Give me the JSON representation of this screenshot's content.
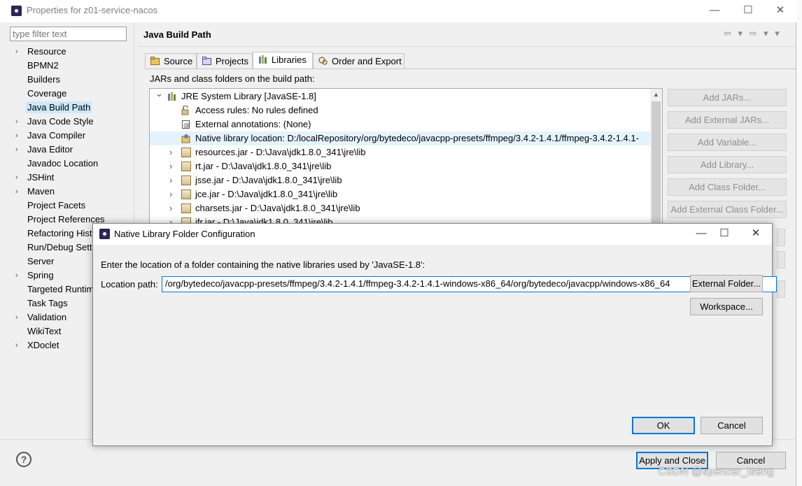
{
  "window": {
    "title": "Properties for z01-service-nacos",
    "minimize": "—",
    "maximize": "☐",
    "close": "✕"
  },
  "filter": {
    "placeholder": "type filter text"
  },
  "tree": [
    {
      "label": "Resource",
      "expandable": true
    },
    {
      "label": "BPMN2",
      "expandable": false
    },
    {
      "label": "Builders",
      "expandable": false
    },
    {
      "label": "Coverage",
      "expandable": false
    },
    {
      "label": "Java Build Path",
      "expandable": false,
      "selected": true
    },
    {
      "label": "Java Code Style",
      "expandable": true
    },
    {
      "label": "Java Compiler",
      "expandable": true
    },
    {
      "label": "Java Editor",
      "expandable": true
    },
    {
      "label": "Javadoc Location",
      "expandable": false
    },
    {
      "label": "JSHint",
      "expandable": true
    },
    {
      "label": "Maven",
      "expandable": true
    },
    {
      "label": "Project Facets",
      "expandable": false
    },
    {
      "label": "Project References",
      "expandable": false
    },
    {
      "label": "Refactoring Hist",
      "expandable": false
    },
    {
      "label": "Run/Debug Setti",
      "expandable": false
    },
    {
      "label": "Server",
      "expandable": false
    },
    {
      "label": "Spring",
      "expandable": true
    },
    {
      "label": "Targeted Runtim",
      "expandable": false
    },
    {
      "label": "Task Tags",
      "expandable": false
    },
    {
      "label": "Validation",
      "expandable": true
    },
    {
      "label": "WikiText",
      "expandable": false
    },
    {
      "label": "XDoclet",
      "expandable": true
    }
  ],
  "panel": {
    "title": "Java Build Path",
    "nav": "⇦ ▾ ⇨ ▾ ▾",
    "tabs": [
      "Source",
      "Projects",
      "Libraries",
      "Order and Export"
    ],
    "active_tab": "Libraries",
    "jars_label": "JARs and class folders on the build path:"
  },
  "libraries": [
    {
      "text": "JRE System Library [JavaSE-1.8]",
      "level": 0,
      "exp": "⌄"
    },
    {
      "text": "Access rules: No rules defined",
      "level": 1,
      "exp": ""
    },
    {
      "text": "External annotations: (None)",
      "level": 1,
      "exp": ""
    },
    {
      "text": "Native library location: D:/localRepository/org/bytedeco/javacpp-presets/ffmpeg/3.4.2-1.4.1/ffmpeg-3.4.2-1.4.1-",
      "level": 1,
      "exp": "",
      "highlight": true
    },
    {
      "text": "resources.jar - D:\\Java\\jdk1.8.0_341\\jre\\lib",
      "level": 1,
      "exp": "›"
    },
    {
      "text": "rt.jar - D:\\Java\\jdk1.8.0_341\\jre\\lib",
      "level": 1,
      "exp": "›"
    },
    {
      "text": "jsse.jar - D:\\Java\\jdk1.8.0_341\\jre\\lib",
      "level": 1,
      "exp": "›"
    },
    {
      "text": "jce.jar - D:\\Java\\jdk1.8.0_341\\jre\\lib",
      "level": 1,
      "exp": "›"
    },
    {
      "text": "charsets.jar - D:\\Java\\jdk1.8.0_341\\jre\\lib",
      "level": 1,
      "exp": "›"
    },
    {
      "text": "jfr.jar - D:\\Java\\jdk1.8.0_341\\jre\\lib",
      "level": 1,
      "exp": "›"
    }
  ],
  "side_buttons": [
    "Add JARs...",
    "Add External JARs...",
    "Add Variable...",
    "Add Library...",
    "Add Class Folder...",
    "Add External Class Folder..."
  ],
  "bottom": {
    "help": "?",
    "apply_close": "Apply and Close",
    "cancel": "Cancel"
  },
  "dialog": {
    "title": "Native Library Folder Configuration",
    "minimize": "—",
    "maximize": "☐",
    "close": "✕",
    "instruction": "Enter the location of a folder containing the native libraries used by 'JavaSE-1.8':",
    "location_label": "Location path:",
    "location_value": "/org/bytedeco/javacpp-presets/ffmpeg/3.4.2-1.4.1/ffmpeg-3.4.2-1.4.1-windows-x86_64/org/bytedeco/javacpp/windows-x86_64",
    "external_folder": "External Folder...",
    "workspace": "Workspace...",
    "ok": "OK",
    "cancel": "Cancel"
  },
  "watermark": "CSDN @spencer_tseng"
}
